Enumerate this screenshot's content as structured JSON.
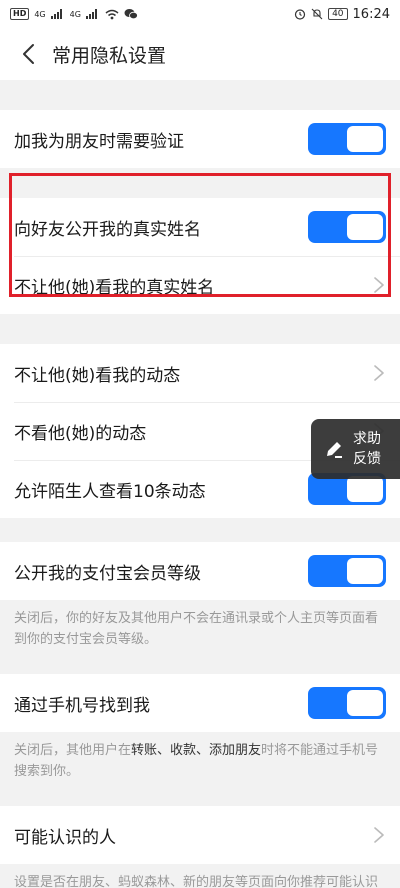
{
  "statusbar": {
    "hd_label": "HD",
    "net1": "4G",
    "net2": "4G",
    "battery": "40",
    "time": "16:24"
  },
  "header": {
    "title": "常用隐私设置"
  },
  "settings": {
    "verify_friend": "加我为朋友时需要验证",
    "show_real_name": "向好友公开我的真实姓名",
    "hide_real_name": "不让他(她)看我的真实姓名",
    "hide_my_moments": "不让他(她)看我的动态",
    "not_see_their_moments": "不看他(她)的动态",
    "stranger_view_10": "允许陌生人查看10条动态",
    "show_member_level": "公开我的支付宝会员等级",
    "member_level_note": "关闭后，你的好友及其他用户不会在通讯录或个人主页等页面看到你的支付宝会员等级。",
    "find_by_phone": "通过手机号找到我",
    "phone_note_prefix": "关闭后，其他用户在",
    "phone_note_bold": "转账、收款、添加朋友",
    "phone_note_suffix": "时将不能通过手机号搜索到你。",
    "people_you_may_know": "可能认识的人",
    "people_note": "设置是否在朋友、蚂蚁森林、新的朋友等页面向你推荐可能认识的人。"
  },
  "toggles": {
    "verify_friend": true,
    "show_real_name": true,
    "stranger_view_10": true,
    "show_member_level": true,
    "find_by_phone": true
  },
  "feedback": {
    "line1": "求助",
    "line2": "反馈"
  },
  "colors": {
    "accent": "#1677ff",
    "highlight": "#e0202a"
  }
}
